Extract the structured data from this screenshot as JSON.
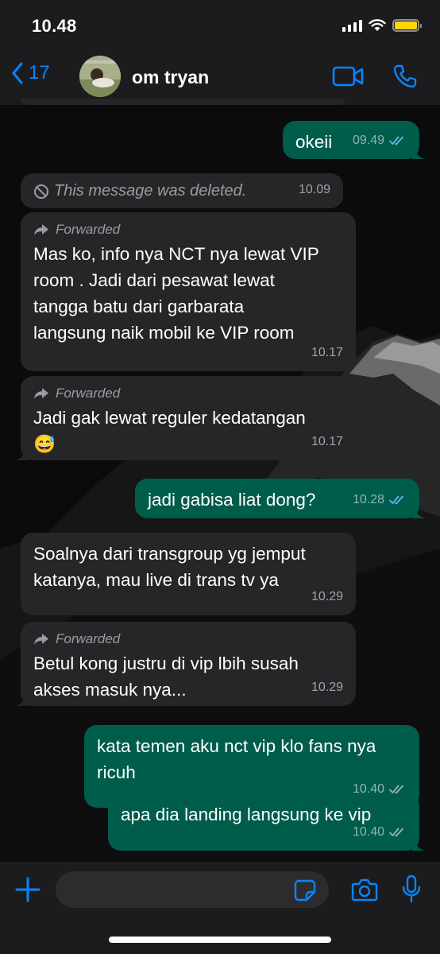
{
  "status_bar": {
    "time": "10.48",
    "battery_level": 1.0
  },
  "header": {
    "back_count": "17",
    "contact_name": "om tryan"
  },
  "messages": [
    {
      "dir": "out",
      "text": "okeii",
      "time": "09.49",
      "ticks": "read"
    },
    {
      "dir": "in",
      "deleted": true,
      "text": "This message was deleted.",
      "time": "10.09"
    },
    {
      "dir": "in",
      "forwarded": true,
      "forwarded_label": "Forwarded",
      "text": "Mas ko, info nya NCT nya lewat VIP\nroom . Jadi dari pesawat lewat\ntangga batu dari garbarata\nlangsung naik mobil ke VIP room",
      "time": "10.17"
    },
    {
      "dir": "in",
      "forwarded": true,
      "forwarded_label": "Forwarded",
      "text": "Jadi gak lewat reguler kedatangan\n😅",
      "time": "10.17"
    },
    {
      "dir": "out",
      "text": "jadi gabisa liat dong?",
      "time": "10.28",
      "ticks": "read"
    },
    {
      "dir": "in",
      "text": "Soalnya dari transgroup yg jemput\nkatanya, mau live di trans tv ya",
      "time": "10.29"
    },
    {
      "dir": "in",
      "forwarded": true,
      "forwarded_label": "Forwarded",
      "text": "Betul kong justru di vip lbih susah\nakses masuk nya...",
      "time": "10.29"
    },
    {
      "dir": "out",
      "text": "kata temen aku nct vip klo fans nya\nricuh",
      "time": "10.40",
      "ticks": "delivered"
    },
    {
      "dir": "out",
      "text": "apa dia landing langsung ke vip",
      "time": "10.40",
      "ticks": "delivered"
    }
  ],
  "input": {
    "placeholder": ""
  },
  "colors": {
    "accent": "#0a84ff",
    "incoming": "#262628",
    "outgoing": "#005c4b",
    "read_tick": "#53bdeb",
    "battery": "#ffd60a"
  }
}
